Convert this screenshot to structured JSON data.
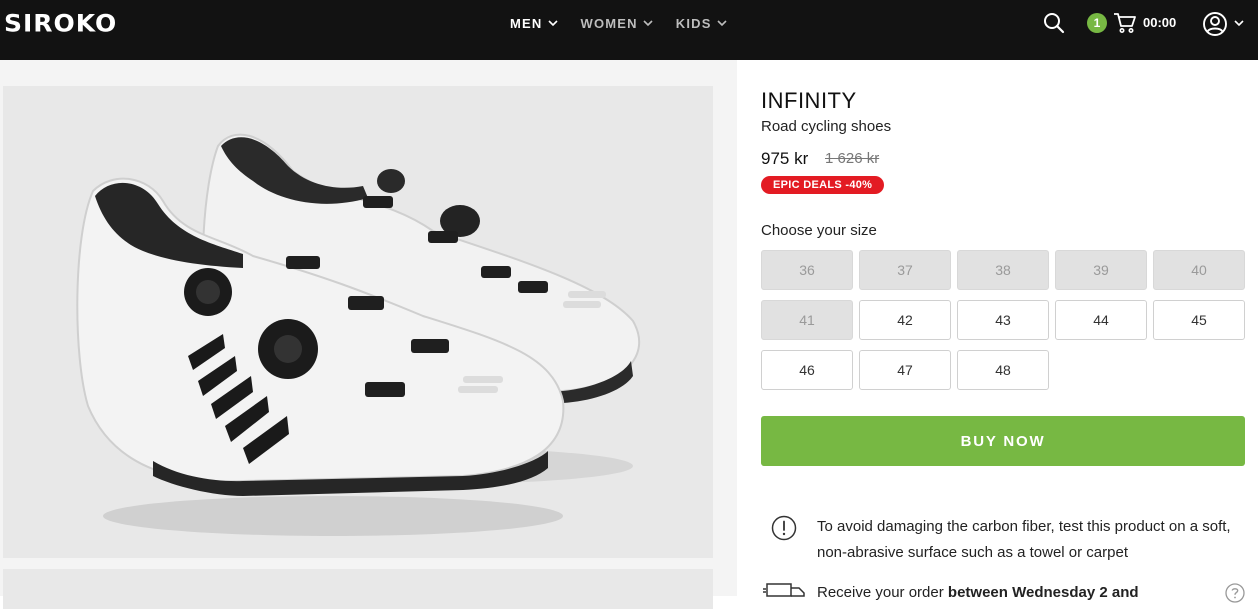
{
  "header": {
    "logo": "SIROKO",
    "nav": [
      {
        "label": "MEN",
        "active": true
      },
      {
        "label": "WOMEN",
        "active": false
      },
      {
        "label": "KIDS",
        "active": false
      }
    ],
    "icons": {
      "search": "search-icon",
      "cart": "cart-icon",
      "account": "user-icon"
    },
    "cart_count": "1",
    "cart_timer": "00:00"
  },
  "product": {
    "title": "INFINITY",
    "subtitle": "Road cycling shoes",
    "price": "975 kr",
    "old_price": "1 626 kr",
    "deal_badge": "EPIC DEALS -40%",
    "size_label": "Choose your size",
    "sizes": [
      {
        "label": "36",
        "available": false
      },
      {
        "label": "37",
        "available": false
      },
      {
        "label": "38",
        "available": false
      },
      {
        "label": "39",
        "available": false
      },
      {
        "label": "40",
        "available": false
      },
      {
        "label": "41",
        "available": false
      },
      {
        "label": "42",
        "available": true
      },
      {
        "label": "43",
        "available": true
      },
      {
        "label": "44",
        "available": true
      },
      {
        "label": "45",
        "available": true
      },
      {
        "label": "46",
        "available": true
      },
      {
        "label": "47",
        "available": true
      },
      {
        "label": "48",
        "available": true
      }
    ],
    "buy_label": "BUY NOW",
    "warning": "To avoid damaging the carbon fiber, test this product on a soft, non-abrasive surface such as a towel or carpet",
    "delivery_prefix": "Receive your order ",
    "delivery_bold": "between Wednesday 2 and"
  },
  "colors": {
    "topbar": "#121212",
    "accent_green": "#77b843",
    "deal_red": "#e31b23",
    "unavailable_size": "#e1e1e1"
  }
}
